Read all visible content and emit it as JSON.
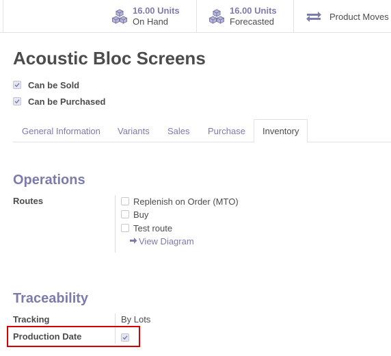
{
  "stat_buttons": {
    "on_hand": {
      "value": "16.00 Units",
      "label": "On Hand",
      "icon": "cubes-icon"
    },
    "forecasted": {
      "value": "16.00 Units",
      "label": "Forecasted",
      "icon": "cubes-icon"
    },
    "moves": {
      "label": "Product Moves",
      "icon": "exchange-arrows-icon"
    }
  },
  "product": {
    "name": "Acoustic Bloc Screens",
    "can_be_sold_label": "Can be Sold",
    "can_be_sold": true,
    "can_be_purchased_label": "Can be Purchased",
    "can_be_purchased": true
  },
  "tabs": [
    {
      "label": "General Information",
      "active": false
    },
    {
      "label": "Variants",
      "active": false
    },
    {
      "label": "Sales",
      "active": false
    },
    {
      "label": "Purchase",
      "active": false
    },
    {
      "label": "Inventory",
      "active": true
    }
  ],
  "operations": {
    "title": "Operations",
    "routes_label": "Routes",
    "routes": [
      {
        "label": "Replenish on Order (MTO)",
        "checked": false
      },
      {
        "label": "Buy",
        "checked": false
      },
      {
        "label": "Test route",
        "checked": false
      }
    ],
    "view_diagram": "View Diagram"
  },
  "traceability": {
    "title": "Traceability",
    "tracking_label": "Tracking",
    "tracking_value": "By Lots",
    "production_date_label": "Production Date",
    "production_date_checked": true
  },
  "colors": {
    "accent": "#7c7bad",
    "text": "#4c4c4c",
    "highlight_border": "#d50000"
  }
}
